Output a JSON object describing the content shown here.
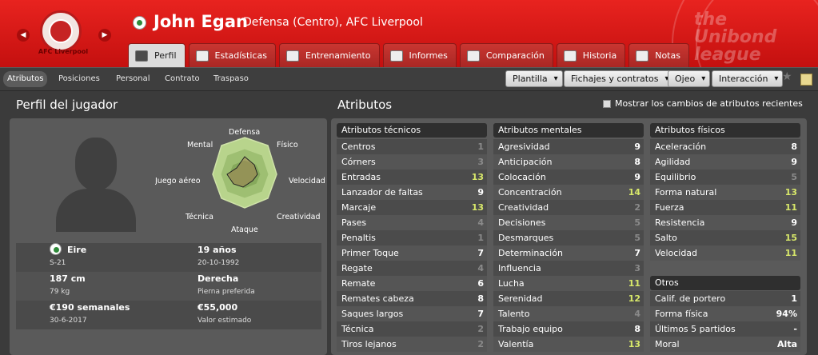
{
  "header": {
    "club_name": "AFC Liverpool",
    "player_name": "John Egan",
    "player_desc": "Defensa (Centro), AFC Liverpool",
    "league_lines": [
      "the",
      "Unibond",
      "league"
    ],
    "brand_color": "#d8191a"
  },
  "tabs": [
    {
      "label": "Perfil"
    },
    {
      "label": "Estadísticas"
    },
    {
      "label": "Entrenamiento"
    },
    {
      "label": "Informes"
    },
    {
      "label": "Comparación"
    },
    {
      "label": "Historia"
    },
    {
      "label": "Notas"
    }
  ],
  "subtabs": [
    "Atributos",
    "Posiciones",
    "Personal",
    "Contrato",
    "Traspaso"
  ],
  "menus": [
    "Plantilla",
    "Fichajes y contratos",
    "Ojeo",
    "Interacción"
  ],
  "profile": {
    "title": "Perfil del jugador",
    "radar_labels": [
      "Defensa",
      "Físico",
      "Velocidad",
      "Creatividad",
      "Ataque",
      "Técnica",
      "Juego aéreo",
      "Mental"
    ],
    "nationality": "Eire",
    "nationality_sub": "S-21",
    "age": "19 años",
    "dob": "20-10-1992",
    "height": "187 cm",
    "weight": "79 kg",
    "foot": "Derecha",
    "foot_label": "Pierna preferida",
    "wage": "€190 semanales",
    "contract_end": "30-6-2017",
    "value": "€55,000",
    "value_label": "Valor estimado"
  },
  "attributes": {
    "title": "Atributos",
    "show_changes_label": "Mostrar los cambios de atributos recientes",
    "technical_title": "Atributos técnicos",
    "technical": [
      {
        "name": "Centros",
        "value": "1"
      },
      {
        "name": "Córners",
        "value": "3"
      },
      {
        "name": "Entradas",
        "value": "13"
      },
      {
        "name": "Lanzador de faltas",
        "value": "9"
      },
      {
        "name": "Marcaje",
        "value": "13"
      },
      {
        "name": "Pases",
        "value": "4"
      },
      {
        "name": "Penaltis",
        "value": "1"
      },
      {
        "name": "Primer Toque",
        "value": "7"
      },
      {
        "name": "Regate",
        "value": "4"
      },
      {
        "name": "Remate",
        "value": "6"
      },
      {
        "name": "Remates cabeza",
        "value": "8"
      },
      {
        "name": "Saques largos",
        "value": "7"
      },
      {
        "name": "Técnica",
        "value": "2"
      },
      {
        "name": "Tiros lejanos",
        "value": "2"
      }
    ],
    "mental_title": "Atributos mentales",
    "mental": [
      {
        "name": "Agresividad",
        "value": "9"
      },
      {
        "name": "Anticipación",
        "value": "8"
      },
      {
        "name": "Colocación",
        "value": "9"
      },
      {
        "name": "Concentración",
        "value": "14"
      },
      {
        "name": "Creatividad",
        "value": "2"
      },
      {
        "name": "Decisiones",
        "value": "5"
      },
      {
        "name": "Desmarques",
        "value": "5"
      },
      {
        "name": "Determinación",
        "value": "7"
      },
      {
        "name": "Influencia",
        "value": "3"
      },
      {
        "name": "Lucha",
        "value": "11"
      },
      {
        "name": "Serenidad",
        "value": "12"
      },
      {
        "name": "Talento",
        "value": "4"
      },
      {
        "name": "Trabajo equipo",
        "value": "8"
      },
      {
        "name": "Valentía",
        "value": "13"
      }
    ],
    "physical_title": "Atributos físicos",
    "physical": [
      {
        "name": "Aceleración",
        "value": "8"
      },
      {
        "name": "Agilidad",
        "value": "9"
      },
      {
        "name": "Equilibrio",
        "value": "5"
      },
      {
        "name": "Forma natural",
        "value": "13"
      },
      {
        "name": "Fuerza",
        "value": "11"
      },
      {
        "name": "Resistencia",
        "value": "9"
      },
      {
        "name": "Salto",
        "value": "15"
      },
      {
        "name": "Velocidad",
        "value": "11"
      }
    ],
    "other_title": "Otros",
    "other": [
      {
        "name": "Calif. de portero",
        "value": "1"
      },
      {
        "name": "Forma física",
        "value": "94%"
      },
      {
        "name": "Últimos 5 partidos",
        "value": "-"
      },
      {
        "name": "Moral",
        "value": "Alta"
      }
    ]
  }
}
